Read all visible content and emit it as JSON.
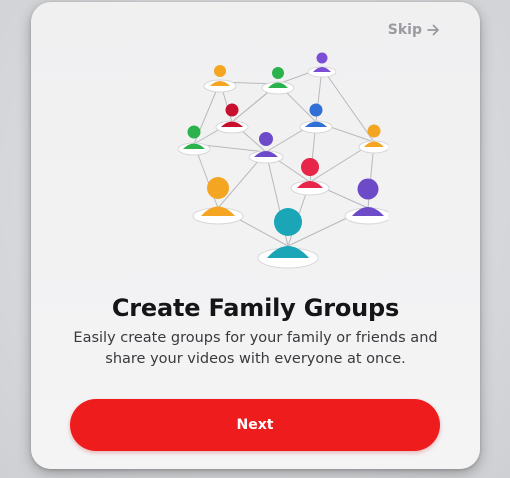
{
  "onboarding": {
    "skip_label": "Skip",
    "skip_icon": "arrow-right-icon",
    "illustration": "family-network-illustration",
    "title": "Create Family Groups",
    "subtitle": "Easily create groups for your family or friends and share your videos with everyone at once.",
    "next_label": "Next"
  },
  "colors": {
    "accent": "#ee1c1c",
    "skip_text": "#9a9aa0",
    "title_text": "#151518",
    "subtitle_text": "#3a3a3e"
  }
}
